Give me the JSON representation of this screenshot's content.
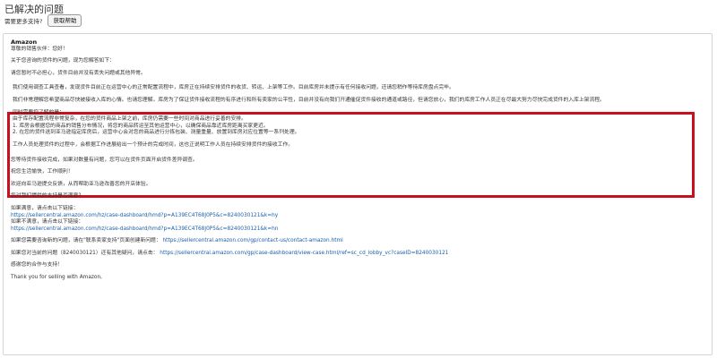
{
  "header": {
    "title": "已解决的问题",
    "question": "需要更多支持?",
    "help_button": "获取帮助"
  },
  "message": {
    "sender": "Amazon",
    "greeting": "尊敬的销售伙伴：您好！",
    "intro": "关于您咨询的货件的问题，现为您解答如下：",
    "reassure": "请您暂时不必担心，货件目前并没有丢失问题或其他异常。",
    "highlight": {
      "p1": "我们使用调查工具查看，发现货件目前正在运营中心的正常配置流程中，库房正在持续安排货件的收货、转运、上架等工作。目前库房并未提示有任何接收问题，还请您稍作等待库房盘点完毕。",
      "p2": "我们非常理解您希望商品尽快被接收入库的心情。也请您理解，库房为了保证货件接收流程的有序进行和所有卖家的公平性，目前并没有向我们开通催促货件接收的通道或路径，但请您放心，我们的库房工作人员正在尽最大努力尽快完成货件的入库上架流程。",
      "p3_title": "同时需要您了解的是：",
      "p3_l1": "由于库存配置流程非常复杂，在您的货件商品上架之前，库房仍需要一些时间对商品进行妥善的安排。",
      "p3_l2": "1. 库房会根据您的商品的销售分布情况，将您的商品转运至其他运营中心，以确保商品靠近库房距离买家更近。",
      "p3_l3": "2. 在您的货件送到亚马逊指定库房后，运营中心会对您的商品进行分拣包装、测量重量、放置到库房对应位置等一系列处理。",
      "p4": "工作人员处理货件的过程中，会根据工作进展给出一个预计的完成时间，这也正说明工作人员在持续安排货件的接收工作。"
    },
    "after1": "您等待货件接收完成，如果对数量有问题，您可以在货件页面开启货件差异调查。",
    "wishes": "祝您生活愉快，工作顺利！",
    "welcome": "欢迎向亚马逊提交反馈，从而帮助亚马逊改善您的开店体验。",
    "satisfaction_q": "您对我们提供的支持是否满意？",
    "satisfied_label": "如果满意，请点击以下链接：",
    "satisfied_link": "https://sellercentral.amazon.com/hz/case-dashboard/hmd?p=A139EC4T68J0P5&c=8240030121&k=hy",
    "unsatisfied_label": "如果不满意，请点击以下链接：",
    "unsatisfied_link": "https://sellercentral.amazon.com/hz/case-dashboard/hmd?p=A139EC4T68J0P5&c=8240030121&k=hn",
    "new_issue_prefix": "如果您需要咨询新的问题，请在\"联系卖家支持\"页面创建新问题：",
    "new_issue_link": "https://sellercentral.amazon.com/gp/contact-us/contact-amazon.html",
    "followup_prefix": "如果您对当前的问题（8240030121）还有其他疑问，请点击：",
    "followup_link": "https://sellercentral.amazon.com/gp/case-dashboard/view-case.html/ref=sc_cd_lobby_vc?caseID=8240030121",
    "thanks": "感谢您的合作与支持！",
    "closing": "Thank you for selling with Amazon,"
  },
  "colors": {
    "highlight_border": "#c8101e",
    "link": "#1a5ea8"
  }
}
